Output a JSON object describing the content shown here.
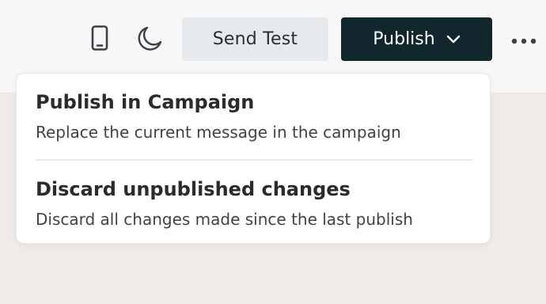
{
  "toolbar": {
    "mobile_preview_icon": "mobile-phone-icon",
    "dark_mode_icon": "crescent-moon-icon",
    "send_test_label": "Send Test",
    "publish_label": "Publish",
    "publish_chevron_icon": "chevron-down-icon",
    "more_icon": "more-horizontal-icon"
  },
  "publish_menu": {
    "items": [
      {
        "title": "Publish in Campaign",
        "description": "Replace the current message in the campaign"
      },
      {
        "title": "Discard unpublished changes",
        "description": "Discard all changes made since the last publish"
      }
    ]
  },
  "colors": {
    "publish_bg": "#12262e",
    "send_test_bg": "#e7eaec",
    "canvas_bg": "#efebe8",
    "toolbar_bg": "#f7f7f7"
  }
}
